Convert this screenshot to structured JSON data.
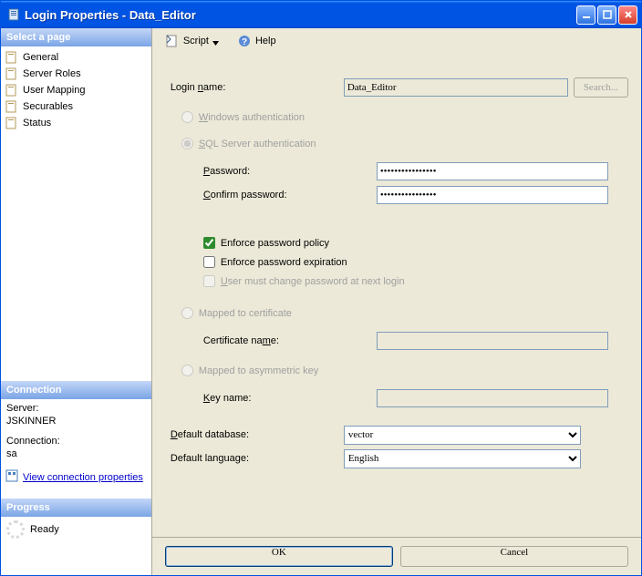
{
  "window": {
    "title": "Login Properties - Data_Editor"
  },
  "sidebar": {
    "select_header": "Select a page",
    "pages": [
      {
        "label": "General"
      },
      {
        "label": "Server Roles"
      },
      {
        "label": "User Mapping"
      },
      {
        "label": "Securables"
      },
      {
        "label": "Status"
      }
    ],
    "connection_header": "Connection",
    "connection": {
      "server_label": "Server:",
      "server_value": "JSKINNER",
      "conn_label": "Connection:",
      "conn_value": "sa",
      "view_conn_link": "View connection properties"
    },
    "progress_header": "Progress",
    "progress_status": "Ready"
  },
  "toolbar": {
    "script_label": "Script",
    "help_label": "Help"
  },
  "form": {
    "login_name_label": "Login name:",
    "login_name_value": "Data_Editor",
    "search_btn": "Search...",
    "windows_auth_label": "Windows authentication",
    "sql_auth_label": "SQL Server authentication",
    "password_label": "Password:",
    "password_value": "••••••••••••••••",
    "confirm_label": "Confirm password:",
    "confirm_value": "••••••••••••••••",
    "enforce_policy_label": "Enforce password policy",
    "enforce_expiry_label": "Enforce password expiration",
    "must_change_label": "User must change password at next login",
    "mapped_cert_label": "Mapped to certificate",
    "cert_name_label": "Certificate name:",
    "mapped_asym_label": "Mapped to asymmetric key",
    "key_name_label": "Key name:",
    "default_db_label": "Default database:",
    "default_db_value": "vector",
    "default_lang_label": "Default language:",
    "default_lang_value": "English"
  },
  "footer": {
    "ok": "OK",
    "cancel": "Cancel"
  }
}
